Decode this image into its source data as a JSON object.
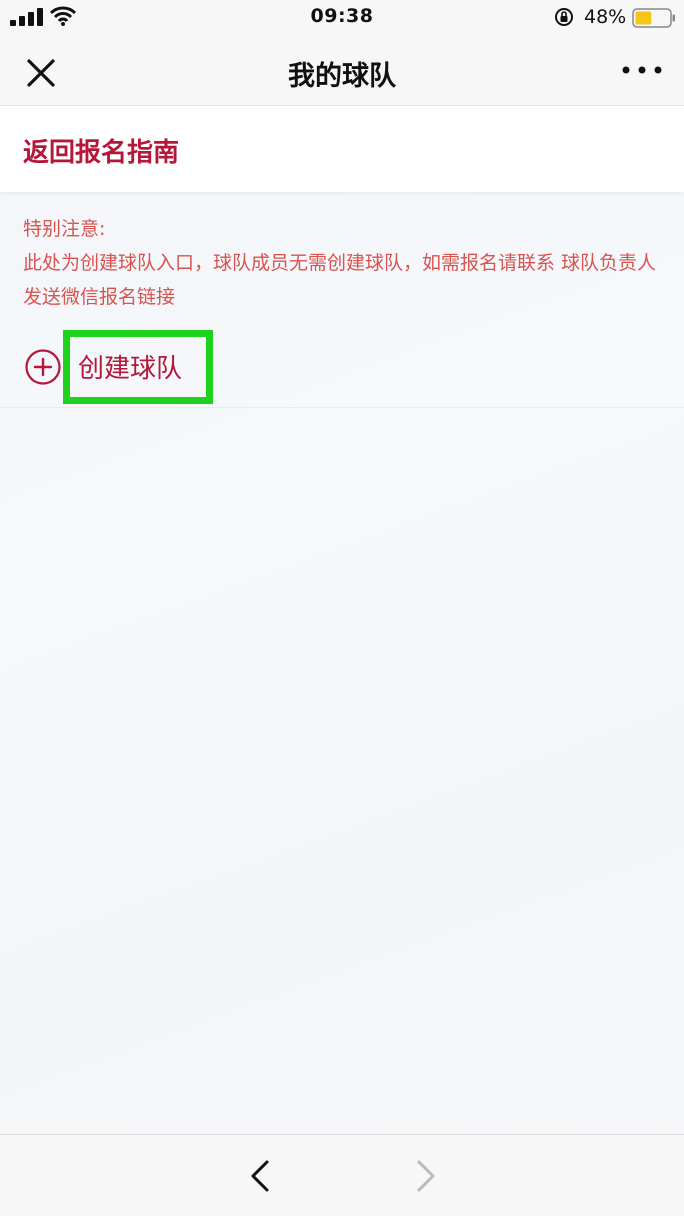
{
  "status_bar": {
    "time": "09:38",
    "battery_percent": "48%",
    "battery_level": 0.48
  },
  "nav": {
    "title": "我的球队"
  },
  "back_guide": {
    "label": "返回报名指南"
  },
  "notice": {
    "title": "特别注意:",
    "body": "此处为创建球队入口，球队成员无需创建球队，如需报名请联系 球队负责人发送微信报名链接"
  },
  "create_team": {
    "label": "创建球队"
  },
  "colors": {
    "accent": "#b5173a",
    "notice": "#d9534f",
    "highlight": "#1fd21f",
    "battery": "#f5c518"
  }
}
